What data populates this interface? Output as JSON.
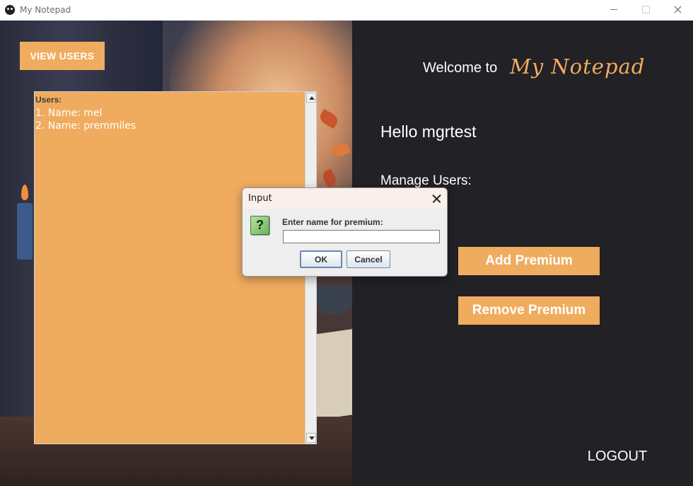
{
  "window": {
    "title": "My Notepad"
  },
  "left": {
    "view_users_label": "VIEW USERS",
    "users_heading": "Users:",
    "users": [
      "1. Name: mel",
      "2. Name: premmiles"
    ]
  },
  "right": {
    "welcome": "Welcome to",
    "brand": "My Notepad",
    "hello": "Hello mgrtest",
    "manage": "Manage Users:",
    "add_premium": "Add Premium",
    "remove_premium": "Remove Premium",
    "logout": "LOGOUT"
  },
  "dialog": {
    "title": "Input",
    "icon": "question-icon",
    "prompt": "Enter name for premium:",
    "input_value": "",
    "ok": "OK",
    "cancel": "Cancel"
  },
  "colors": {
    "accent": "#f0ac5e",
    "dark_panel": "#222125",
    "text_light": "#ffffff"
  }
}
